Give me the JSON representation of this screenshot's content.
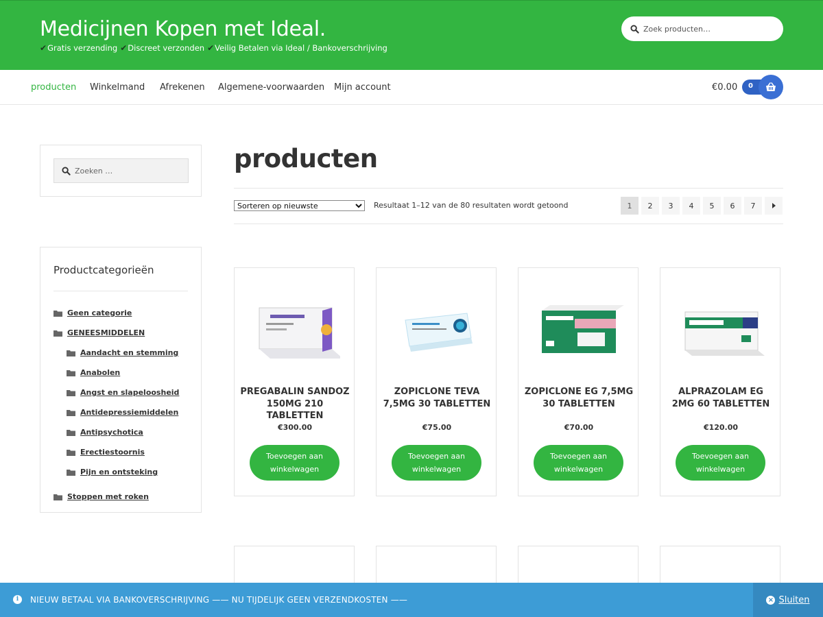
{
  "header": {
    "site_title": "Medicijnen Kopen met Ideal.",
    "tagline_parts": [
      "Gratis verzending",
      "Discreet verzonden",
      "Veilig Betalen via Ideal / Bankoverschrijving"
    ],
    "search_placeholder": "Zoek producten…",
    "brand_color": "#33b541"
  },
  "nav": {
    "items": [
      {
        "label": "producten",
        "active": true
      },
      {
        "label": "Winkelmand"
      },
      {
        "label": "Afrekenen"
      },
      {
        "label": "Algemene-voorwaarden"
      },
      {
        "label": "Mijn account"
      }
    ],
    "cart_total": "€0.00",
    "cart_count": "0"
  },
  "sidebar": {
    "search_placeholder": "Zoeken …",
    "categories_title": "Productcategorieën",
    "categories": [
      {
        "label": "Geen categorie",
        "level": 0
      },
      {
        "label": "GENEESMIDDELEN",
        "level": 0
      },
      {
        "label": "Aandacht en stemming",
        "level": 1
      },
      {
        "label": "Anabolen",
        "level": 1
      },
      {
        "label": "Angst en slapeloosheid",
        "level": 1
      },
      {
        "label": "Antidepressiemiddelen",
        "level": 1
      },
      {
        "label": "Antipsychotica",
        "level": 1
      },
      {
        "label": "Erectiestoornis",
        "level": 1
      },
      {
        "label": "Pijn en ontsteking",
        "level": 1
      },
      {
        "label": "Stoppen met roken",
        "level": 0
      }
    ]
  },
  "main": {
    "page_title": "producten",
    "sort_selected": "Sorteren op nieuwste",
    "result_count": "Resultaat 1–12 van de 80 resultaten wordt getoond",
    "pages": [
      "1",
      "2",
      "3",
      "4",
      "5",
      "6",
      "7"
    ],
    "current_page": "1",
    "next_icon": "caret-right-icon"
  },
  "products": [
    {
      "name": "PREGABALIN SANDOZ 150MG 210 TABLETTEN",
      "price": "€300.00",
      "button": "Toevoegen aan winkelwagen",
      "box_color": "#e9e4f2"
    },
    {
      "name": "ZOPICLONE TEVA 7,5MG 30 TABLETTEN",
      "price": "€75.00",
      "button": "Toevoegen aan winkelwagen",
      "box_color": "#d7eef8"
    },
    {
      "name": "ZOPICLONE EG 7,5MG 30 TABLETTEN",
      "price": "€70.00",
      "button": "Toevoegen aan winkelwagen",
      "box_color": "#1f8c5a"
    },
    {
      "name": "ALPRAZOLAM EG 2MG 60 TABLETTEN",
      "price": "€120.00",
      "button": "Toevoegen aan winkelwagen",
      "box_color": "#1f8c5a"
    }
  ],
  "notice": {
    "text": "NIEUW BETAAL VIA BANKOVERSCHRIJVING —— NU TIJDELIJK GEEN VERZENDKOSTEN ——",
    "close_label": "Sluiten",
    "color": "#3d9cd6"
  }
}
